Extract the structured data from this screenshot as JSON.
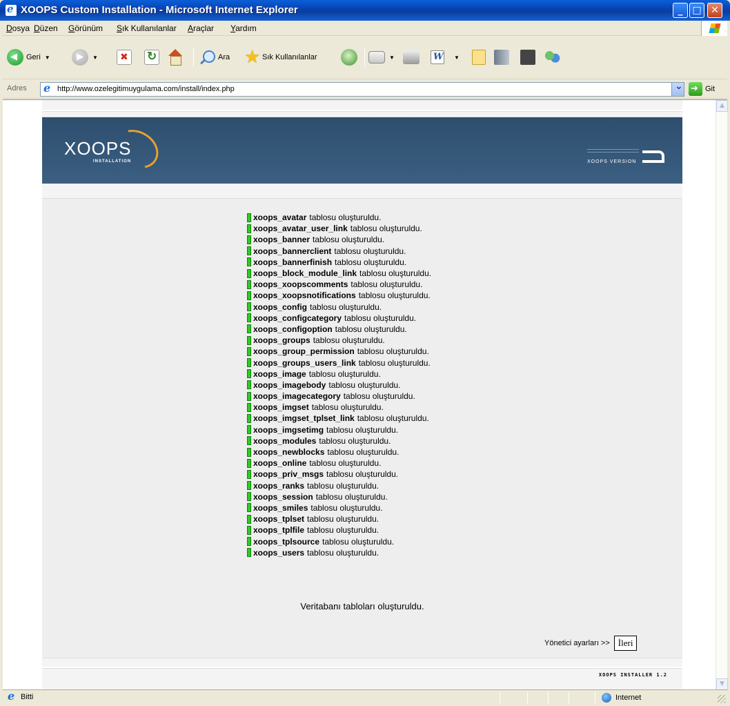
{
  "window": {
    "title": "XOOPS Custom Installation - Microsoft Internet Explorer"
  },
  "menu": {
    "items": [
      "Dosya",
      "Düzen",
      "Görünüm",
      "Sık Kullanılanlar",
      "Araçlar",
      "Yardım"
    ]
  },
  "toolbar": {
    "back_label": "Geri",
    "search_label": "Ara",
    "favorites_label": "Sık Kullanılanlar"
  },
  "address": {
    "label": "Adres",
    "url": "http://www.ozelegitimuygulama.com/install/index.php",
    "go_label": "Git"
  },
  "header": {
    "logo_text": "XOOPS",
    "logo_sub": "INSTALLATION",
    "version_text": "XOOPS VERSION"
  },
  "tables": {
    "suffix": "tablosu oluşturuldu.",
    "names": [
      "xoops_avatar",
      "xoops_avatar_user_link",
      "xoops_banner",
      "xoops_bannerclient",
      "xoops_bannerfinish",
      "xoops_block_module_link",
      "xoops_xoopscomments",
      "xoops_xoopsnotifications",
      "xoops_config",
      "xoops_configcategory",
      "xoops_configoption",
      "xoops_groups",
      "xoops_group_permission",
      "xoops_groups_users_link",
      "xoops_image",
      "xoops_imagebody",
      "xoops_imagecategory",
      "xoops_imgset",
      "xoops_imgset_tplset_link",
      "xoops_imgsetimg",
      "xoops_modules",
      "xoops_newblocks",
      "xoops_online",
      "xoops_priv_msgs",
      "xoops_ranks",
      "xoops_session",
      "xoops_smiles",
      "xoops_tplset",
      "xoops_tplfile",
      "xoops_tplsource",
      "xoops_users"
    ]
  },
  "main": {
    "done_text": "Veritabanı tabloları oluşturuldu.",
    "next_label": "Yönetici ayarları >>",
    "next_button": "İleri"
  },
  "footer": {
    "installer_text": "XOOPS INSTALLER 1.2"
  },
  "status": {
    "text": "Bitti",
    "zone": "Internet"
  },
  "colors": {
    "header_bg": "#345677",
    "ok_marker": "#2ccc1e",
    "logo_accent": "#e9a12a"
  }
}
